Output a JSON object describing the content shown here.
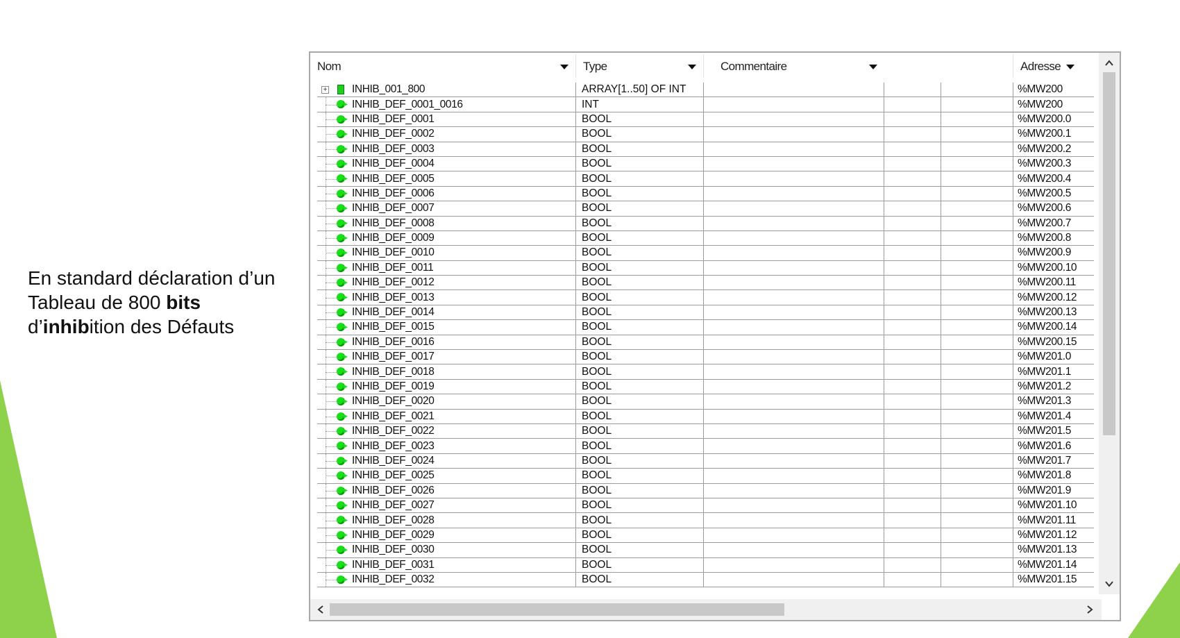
{
  "description": {
    "line1": "En standard déclaration d’un",
    "line2_a": "Tableau de 800 ",
    "line2_b": "bits",
    "line3_a": "d’",
    "line3_b": "inhib",
    "line3_c": "ition des Défauts"
  },
  "table": {
    "columns": {
      "name": "Nom",
      "type": "Type",
      "comment": "Commentaire",
      "address": "Adresse"
    },
    "rows": [
      {
        "name": "INHIB_001_800",
        "type": "ARRAY[1..50] OF INT",
        "address": "%MW200"
      },
      {
        "name": "INHIB_DEF_0001_0016",
        "type": "INT",
        "address": "%MW200"
      },
      {
        "name": "INHIB_DEF_0001",
        "type": "BOOL",
        "address": "%MW200.0"
      },
      {
        "name": "INHIB_DEF_0002",
        "type": "BOOL",
        "address": "%MW200.1"
      },
      {
        "name": "INHIB_DEF_0003",
        "type": "BOOL",
        "address": "%MW200.2"
      },
      {
        "name": "INHIB_DEF_0004",
        "type": "BOOL",
        "address": "%MW200.3"
      },
      {
        "name": "INHIB_DEF_0005",
        "type": "BOOL",
        "address": "%MW200.4"
      },
      {
        "name": "INHIB_DEF_0006",
        "type": "BOOL",
        "address": "%MW200.5"
      },
      {
        "name": "INHIB_DEF_0007",
        "type": "BOOL",
        "address": "%MW200.6"
      },
      {
        "name": "INHIB_DEF_0008",
        "type": "BOOL",
        "address": "%MW200.7"
      },
      {
        "name": "INHIB_DEF_0009",
        "type": "BOOL",
        "address": "%MW200.8"
      },
      {
        "name": "INHIB_DEF_0010",
        "type": "BOOL",
        "address": "%MW200.9"
      },
      {
        "name": "INHIB_DEF_0011",
        "type": "BOOL",
        "address": "%MW200.10"
      },
      {
        "name": "INHIB_DEF_0012",
        "type": "BOOL",
        "address": "%MW200.11"
      },
      {
        "name": "INHIB_DEF_0013",
        "type": "BOOL",
        "address": "%MW200.12"
      },
      {
        "name": "INHIB_DEF_0014",
        "type": "BOOL",
        "address": "%MW200.13"
      },
      {
        "name": "INHIB_DEF_0015",
        "type": "BOOL",
        "address": "%MW200.14"
      },
      {
        "name": "INHIB_DEF_0016",
        "type": "BOOL",
        "address": "%MW200.15"
      },
      {
        "name": "INHIB_DEF_0017",
        "type": "BOOL",
        "address": "%MW201.0"
      },
      {
        "name": "INHIB_DEF_0018",
        "type": "BOOL",
        "address": "%MW201.1"
      },
      {
        "name": "INHIB_DEF_0019",
        "type": "BOOL",
        "address": "%MW201.2"
      },
      {
        "name": "INHIB_DEF_0020",
        "type": "BOOL",
        "address": "%MW201.3"
      },
      {
        "name": "INHIB_DEF_0021",
        "type": "BOOL",
        "address": "%MW201.4"
      },
      {
        "name": "INHIB_DEF_0022",
        "type": "BOOL",
        "address": "%MW201.5"
      },
      {
        "name": "INHIB_DEF_0023",
        "type": "BOOL",
        "address": "%MW201.6"
      },
      {
        "name": "INHIB_DEF_0024",
        "type": "BOOL",
        "address": "%MW201.7"
      },
      {
        "name": "INHIB_DEF_0025",
        "type": "BOOL",
        "address": "%MW201.8"
      },
      {
        "name": "INHIB_DEF_0026",
        "type": "BOOL",
        "address": "%MW201.9"
      },
      {
        "name": "INHIB_DEF_0027",
        "type": "BOOL",
        "address": "%MW201.10"
      },
      {
        "name": "INHIB_DEF_0028",
        "type": "BOOL",
        "address": "%MW201.11"
      },
      {
        "name": "INHIB_DEF_0029",
        "type": "BOOL",
        "address": "%MW201.12"
      },
      {
        "name": "INHIB_DEF_0030",
        "type": "BOOL",
        "address": "%MW201.13"
      },
      {
        "name": "INHIB_DEF_0031",
        "type": "BOOL",
        "address": "%MW201.14"
      },
      {
        "name": "INHIB_DEF_0032",
        "type": "BOOL",
        "address": "%MW201.15"
      }
    ]
  },
  "colors": {
    "accent_green": "#8ed14a",
    "variable_icon": "#18e018"
  },
  "icons": {
    "expander": "plus-square-icon",
    "array": "array-variable-icon",
    "variable": "variable-icon"
  }
}
